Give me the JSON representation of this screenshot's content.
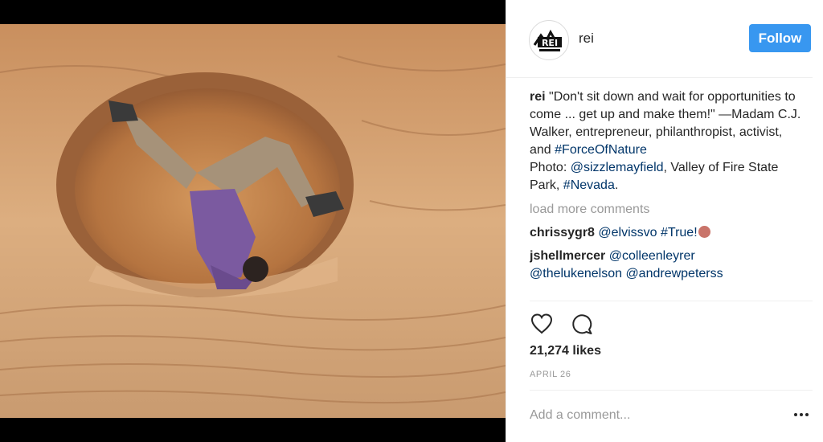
{
  "post": {
    "username": "rei",
    "follow_label": "Follow",
    "photo_alt": "person doing a handstand inside a sandstone cave"
  },
  "caption": {
    "author": "rei",
    "text_1": " \"Don't sit down and wait for opportunities to come ... get up and make them!\" —Madam C.J. Walker, entrepreneur, philanthropist, activist, and ",
    "hashtag_1": "#ForceOfNature",
    "text_2": " Photo: ",
    "mention_1": "@sizzlemayfield",
    "text_3": ", Valley of Fire State Park, ",
    "hashtag_2": "#Nevada",
    "text_4": "."
  },
  "load_more": "load more comments",
  "comments": [
    {
      "author": "chrissygr8",
      "mention": "@elvissvo",
      "hashtag": "#True!"
    },
    {
      "author": "jshellmercer",
      "mentions": [
        "@colleenleyrer",
        "@thelukenelson",
        "@andrewpeterss"
      ]
    }
  ],
  "likes": "21,274 likes",
  "date": "APRIL 26",
  "comment_placeholder": "Add a comment...",
  "icons": {
    "like": "heart-icon",
    "comment": "comment-icon",
    "more": "more-options-icon"
  },
  "colors": {
    "accent": "#3897f0",
    "link": "#003569",
    "muted": "#999999"
  }
}
